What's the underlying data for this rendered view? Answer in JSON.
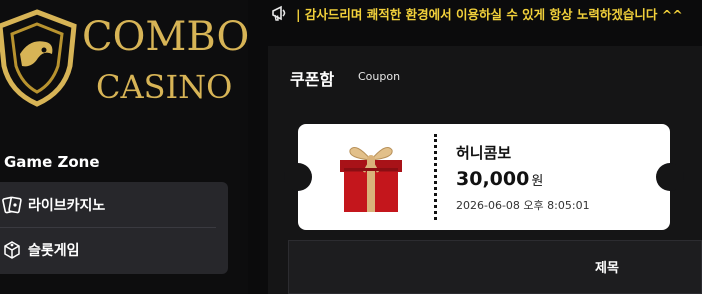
{
  "logo": {
    "line1": "COMBO",
    "line2": "CASINO"
  },
  "sidebar": {
    "zone_title": "Game Zone",
    "items": [
      {
        "label": "라이브카지노",
        "icon": "cards-icon"
      },
      {
        "label": "슬롯게임",
        "icon": "slot-icon"
      }
    ]
  },
  "notice": {
    "icon": "announcement-icon",
    "text": "| 감사드리며 쾌적한 환경에서 이용하실 수 있게 항상 노력하겠습니다 ^^"
  },
  "panel": {
    "title": "쿠폰함",
    "subtitle": "Coupon"
  },
  "coupon": {
    "name": "허니콤보",
    "amount": "30,000",
    "unit": "원",
    "date": "2026-06-08 오후 8:05:01",
    "icon": "gift-box-icon"
  },
  "table": {
    "headers": [
      "제목"
    ]
  },
  "colors": {
    "gold": "#d7b456",
    "notice": "#f2d13b",
    "panel_bg": "#151516",
    "menu_bg": "#27272b"
  }
}
